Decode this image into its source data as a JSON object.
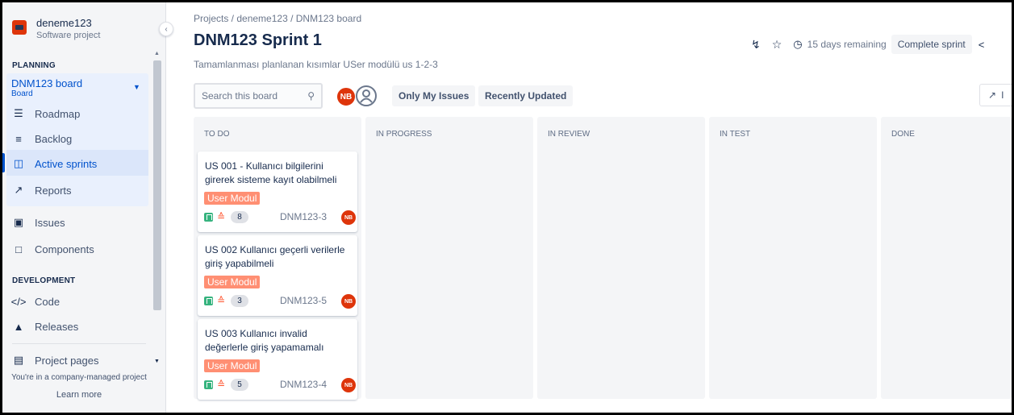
{
  "project": {
    "name": "deneme123",
    "type": "Software project"
  },
  "sidebar": {
    "planning_label": "PLANNING",
    "board": {
      "name": "DNM123 board",
      "sub": "Board"
    },
    "items": [
      {
        "label": "Roadmap",
        "icon": "roadmap-icon"
      },
      {
        "label": "Backlog",
        "icon": "backlog-icon"
      },
      {
        "label": "Active sprints",
        "icon": "board-icon"
      },
      {
        "label": "Reports",
        "icon": "reports-icon"
      },
      {
        "label": "Issues",
        "icon": "issues-icon"
      },
      {
        "label": "Components",
        "icon": "components-icon"
      }
    ],
    "development_label": "DEVELOPMENT",
    "dev_items": [
      {
        "label": "Code",
        "icon": "code-icon"
      },
      {
        "label": "Releases",
        "icon": "releases-icon"
      }
    ],
    "project_pages": "Project pages",
    "footer_note": "You're in a company-managed project",
    "learn_more": "Learn more"
  },
  "header": {
    "breadcrumb": "Projects / deneme123 / DNM123 board",
    "title": "DNM123 Sprint 1",
    "sprint_goal": "Tamamlanması planlanan kısımlar USer modülü us 1-2-3",
    "days_remaining": "15 days remaining",
    "complete_sprint": "Complete sprint"
  },
  "toolbar": {
    "search_placeholder": "Search this board",
    "avatar_initials": "NB",
    "only_my_issues": "Only My Issues",
    "recently_updated": "Recently Updated",
    "insights": "I"
  },
  "columns": [
    {
      "title": "TO DO"
    },
    {
      "title": "IN PROGRESS"
    },
    {
      "title": "IN REVIEW"
    },
    {
      "title": "IN TEST"
    },
    {
      "title": "DONE"
    }
  ],
  "cards": [
    {
      "title": "US 001 - Kullanıcı bilgilerini girerek sisteme kayıt olabilmeli",
      "label": "User Modul",
      "points": "8",
      "key": "DNM123-3",
      "assignee": "NB"
    },
    {
      "title": "US 002 Kullanıcı geçerli verilerle giriş yapabilmeli",
      "label": "User Modul",
      "points": "3",
      "key": "DNM123-5",
      "assignee": "NB"
    },
    {
      "title": "US 003 Kullanıcı invalid değerlerle giriş yapamamalı",
      "label": "User Modul",
      "points": "5",
      "key": "DNM123-4",
      "assignee": "NB"
    }
  ],
  "colors": {
    "accent": "#0052cc",
    "label_bg": "#ff8f73",
    "avatar": "#de350b",
    "story": "#36b37e"
  }
}
